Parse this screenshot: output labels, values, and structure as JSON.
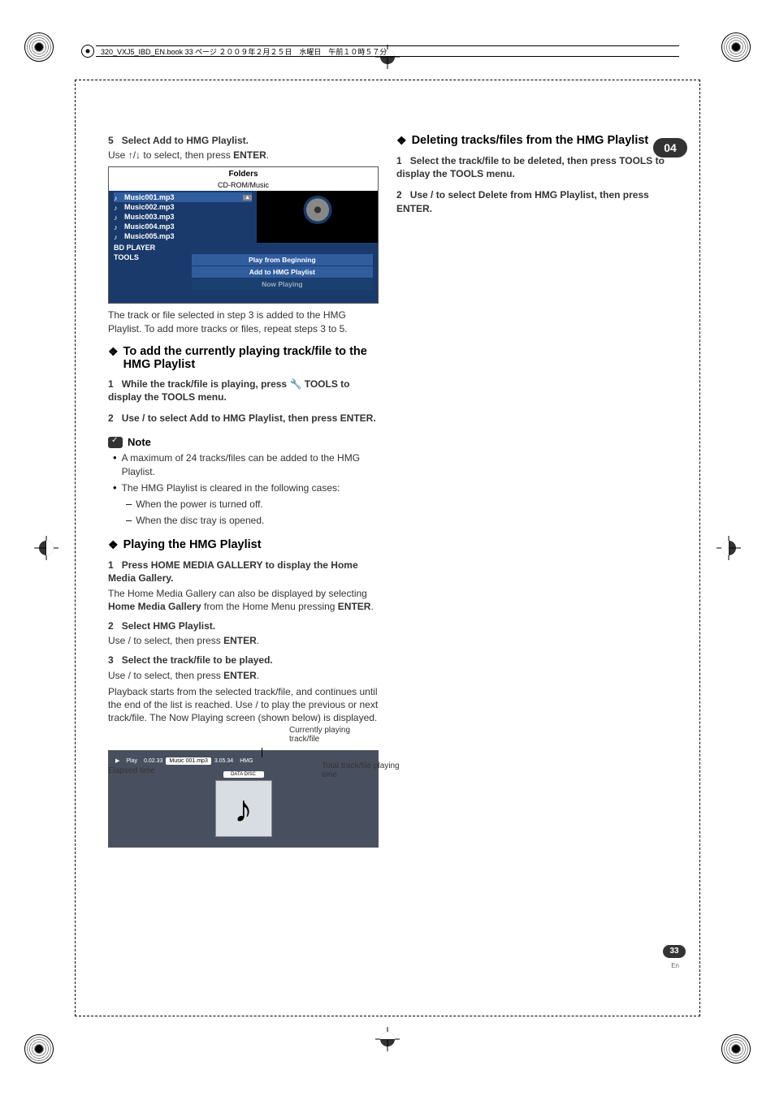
{
  "header_text": "320_VXJ5_IBD_EN.book  33 ページ  ２００９年２月２５日　水曜日　午前１０時５７分",
  "chapter": "04",
  "page_number": "33",
  "page_lang": "En",
  "left": {
    "step5_num": "5",
    "step5_title": "Select Add to HMG Playlist.",
    "step5_body_a": "Use ",
    "step5_body_b": "/",
    "step5_body_c": " to select, then press ",
    "step5_body_enter": "ENTER",
    "step5_body_d": ".",
    "osd": {
      "folders": "Folders",
      "path": "CD-ROM/Music",
      "items": [
        "Music001.mp3",
        "Music002.mp3",
        "Music003.mp3",
        "Music004.mp3",
        "Music005.mp3"
      ],
      "bd": "BD PLAYER",
      "tools": "TOOLS",
      "menu": [
        "Play from Beginning",
        "Add to HMG Playlist",
        "Now Playing"
      ]
    },
    "after5": "The track or file selected in step 3 is added to the HMG Playlist. To add more tracks or files, repeat steps 3 to 5.",
    "h_add": "To add the currently playing track/file to the HMG Playlist",
    "add_s1_n": "1",
    "add_s1": "While the track/file is playing, press ",
    "add_s1_tools": " TOOLS to display the TOOLS menu.",
    "add_s2_n": "2",
    "add_s2": "Use / to select Add to HMG Playlist, then press ENTER.",
    "note": "Note",
    "note_b1": "A maximum of 24 tracks/files can be added to the HMG Playlist.",
    "note_b2": "The HMG Playlist is cleared in the following cases:",
    "note_d1": "When the power is turned off.",
    "note_d2": "When the disc tray is opened.",
    "h_play": "Playing the HMG Playlist",
    "p_s1_n": "1",
    "p_s1": "Press HOME MEDIA GALLERY to display the Home Media Gallery.",
    "p_s1_b": "The Home Media Gallery can also be displayed by selecting ",
    "p_s1_bold": "Home Media Gallery",
    "p_s1_c": " from the Home Menu pressing ",
    "p_s1_enter": "ENTER",
    "p_s1_d": ".",
    "p_s2_n": "2",
    "p_s2": "Select HMG Playlist.",
    "p_s2_b": "Use / to select, then press ",
    "p_s2_enter": "ENTER",
    "p_s2_d": ".",
    "p_s3_n": "3",
    "p_s3": "Select the track/file to be played.",
    "p_s3_b": "Use / to select, then press ",
    "p_s3_enter": "ENTER",
    "p_s3_d": ".",
    "p_after": "Playback starts from the selected track/file, and continues until the end of the list is reached. Use / to play the previous or next track/file. The Now Playing screen (shown below) is displayed.",
    "np": {
      "play": "Play",
      "el": "0.02.33",
      "track": "Music 001.mp3",
      "disc": "DATA DISC",
      "tot": "3.05.34",
      "hmg": "HMG"
    },
    "np_label_top": "Currently playing track/file",
    "np_label_left": "Elapsed time",
    "np_label_right": "Total track/file playing time"
  },
  "right": {
    "h_del": "Deleting tracks/files from the HMG Playlist",
    "d_s1_n": "1",
    "d_s1": "Select the track/file to be deleted, then press  TOOLS to display the TOOLS menu.",
    "d_s2_n": "2",
    "d_s2": "Use / to select Delete from HMG Playlist, then press ENTER."
  }
}
